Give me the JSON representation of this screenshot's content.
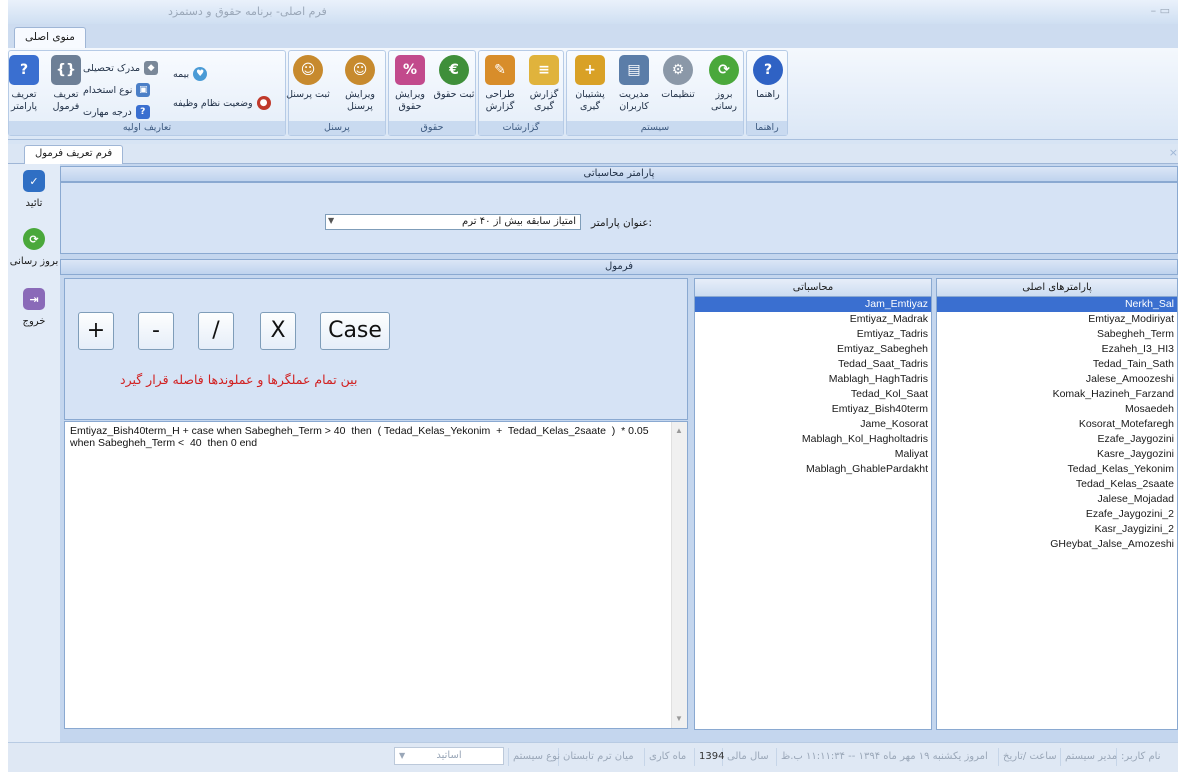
{
  "window": {
    "title": "فرم اصلی- برنامه حقوق و دستمزد",
    "controls": "– ▭"
  },
  "menu": {
    "main_tab": "منوی اصلی"
  },
  "ribbon": {
    "help": {
      "group": "راهنما",
      "button": "راهنما"
    },
    "system": {
      "group": "سیستم",
      "update": "بروز رسانی",
      "settings": "تنظیمات",
      "users": "مدیریت کاربران",
      "backup": "پشتیبان گیری"
    },
    "reports": {
      "group": "گزارشات",
      "report": "گزارش گیری",
      "design": "طراحی گزارش"
    },
    "salary": {
      "group": "حقوق",
      "register": "ثبت حقوق",
      "edit": "ویرایش حقوق"
    },
    "personnel": {
      "group": "پرسنل",
      "register": "ثبت پرسنل",
      "edit": "ویرایش پرسنل"
    },
    "basic": {
      "group": "تعاریف اولیه",
      "job_status": "وضعیت نظام وظیفه",
      "insurance": "بیمه",
      "degree": "مدرک تحصیلی",
      "employment": "نوع استخدام",
      "skill": "درجه مهارت",
      "formula": "تعریف فرمول",
      "param": "تعریف پارامتر"
    }
  },
  "doc_tab": {
    "label": "فرم تعریف فرمول",
    "close": "×"
  },
  "sidebar": {
    "confirm": "تائید",
    "refresh": "بروز رسانی",
    "exit": "خروج"
  },
  "param_section": {
    "header": "پارامتر محاسباتی",
    "label": "عنوان پارامتر:",
    "value": "امتیاز سابقه بیش از ۴۰ ترم"
  },
  "formula_section": {
    "header": "فرمول",
    "operators": [
      "+",
      "-",
      "/",
      "X",
      "Case"
    ],
    "hint": "بین تمام عملگرها و عملوندها فاصله قرار گیرد",
    "text": "Emtiyaz_Bish40term_H + case when Sabegheh_Term > 40  then  ( Tedad_Kelas_Yekonim  +  Tedad_Kelas_2saate  )  * 0.05\nwhen Sabegheh_Term <  40  then 0 end"
  },
  "computed_list": {
    "header": "محاسباتی",
    "items": [
      "Jam_Emtiyaz",
      "Emtiyaz_Madrak",
      "Emtiyaz_Tadris",
      "Emtiyaz_Sabegheh",
      "Tedad_Saat_Tadris",
      "Mablagh_HaghTadris",
      "Tedad_Kol_Saat",
      "Emtiyaz_Bish40term",
      "Jame_Kosorat",
      "Mablagh_Kol_Hagholtadris",
      "Maliyat",
      "Mablagh_GhablePardakht"
    ]
  },
  "main_params_list": {
    "header": "پارامترهای اصلی",
    "items": [
      "Nerkh_Sal",
      "Emtiyaz_Modiriyat",
      "Sabegheh_Term",
      "Ezaheh_I3_HI3",
      "Tedad_Tain_Sath",
      "Jalese_Amoozeshi",
      "Komak_Hazineh_Farzand",
      "Mosaedeh",
      "Kosorat_Motefaregh",
      "Ezafe_Jaygozini",
      "Kasre_Jaygozini",
      "Tedad_Kelas_Yekonim",
      "Tedad_Kelas_2saate",
      "Jalese_Mojadad",
      "Ezafe_Jaygozini_2",
      "Kasr_Jaygizini_2",
      "GHeybat_Jalse_Amozeshi"
    ]
  },
  "status_bar": {
    "user": "نام کاربر:",
    "role": "مدیر سیستم",
    "time_label": "ساعت /تاریخ",
    "date": "امروز یکشنبه ۱۹ مهر ماه ۱۳۹۴ -- ۱۱:۱۱:۳۴ ب.ظ",
    "fiscal_label": "سال مالی",
    "fiscal_year": "1394",
    "month_label": "ماه کاری",
    "term_label": "میان ترم تابستان",
    "system_type": "نوع سیستم",
    "system_value": "اساتید"
  },
  "colors": {
    "accent": "#3a6fd0",
    "hint": "#d11f1f",
    "panel": "#d6e3f5"
  }
}
